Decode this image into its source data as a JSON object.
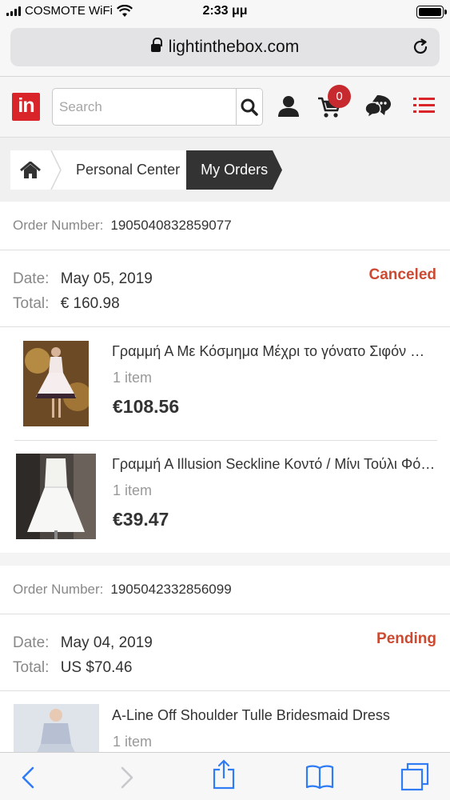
{
  "status_bar": {
    "carrier": "COSMOTE WiFi",
    "time": "2:33 μμ"
  },
  "browser": {
    "url": "lightinthebox.com"
  },
  "header": {
    "logo_text": "in",
    "search_placeholder": "Search",
    "cart_count": "0"
  },
  "breadcrumb": {
    "items": [
      "Personal Center",
      "My Orders"
    ]
  },
  "orders": [
    {
      "number_label": "Order Number:",
      "number": "1905040832859077",
      "date_label": "Date:",
      "date": "May 05, 2019",
      "total_label": "Total:",
      "total": "€ 160.98",
      "status": "Canceled",
      "items": [
        {
          "title": "Γραμμή Α Με Κόσμημα Μέχρι το γόνατο Σιφόν Φόρεμα",
          "qty": "1 item",
          "price": "€108.56"
        },
        {
          "title": "Γραμμή Α Illusion Seckline Κοντό / Μίνι Τούλι Φόρεμα",
          "qty": "1 item",
          "price": "€39.47"
        }
      ]
    },
    {
      "number_label": "Order Number:",
      "number": "1905042332856099",
      "date_label": "Date:",
      "date": "May 04, 2019",
      "total_label": "Total:",
      "total": "US $70.46",
      "status": "Pending",
      "items": [
        {
          "title": "A-Line Off Shoulder Tulle Bridesmaid Dress",
          "qty": "1 item"
        }
      ]
    }
  ],
  "colors": {
    "brand": "#d9252a",
    "status_canceled": "#cc4a32",
    "status_pending": "#cc4a32",
    "ios_blue": "#2f7cf6"
  },
  "icons": {
    "header": [
      "search-icon",
      "user-icon",
      "cart-icon",
      "chat-icon",
      "menu-icon"
    ],
    "toolbar": [
      "back-icon",
      "forward-icon",
      "share-icon",
      "bookmarks-icon",
      "tabs-icon"
    ]
  }
}
